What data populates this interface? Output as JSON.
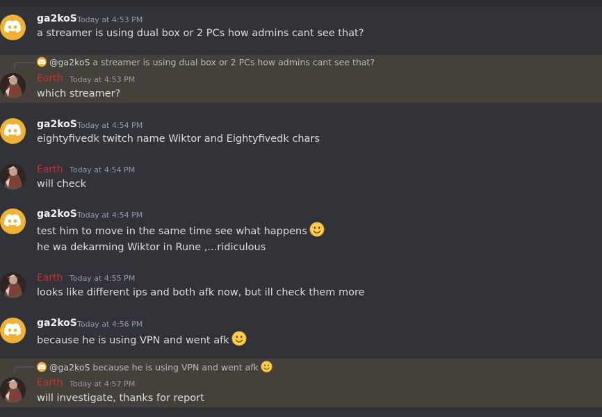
{
  "messages": [
    {
      "author": "ga2koS",
      "time": "Today at 4:53 PM",
      "lines": [
        "a streamer is using dual box or 2 PCs how admins cant see that?"
      ]
    },
    {
      "author": "Earth",
      "time": "Today at 4:53 PM",
      "reply": {
        "author": "@ga2koS",
        "text": "a streamer is using dual box or 2 PCs how admins cant see that?"
      },
      "lines": [
        "which streamer?"
      ]
    },
    {
      "author": "ga2koS",
      "time": "Today at 4:54 PM",
      "lines": [
        "eightyfivedk twitch name Wiktor and Eightyfivedk chars"
      ]
    },
    {
      "author": "Earth",
      "time": "Today at 4:54 PM",
      "lines": [
        "will check"
      ]
    },
    {
      "author": "ga2koS",
      "time": "Today at 4:54 PM",
      "lines": [
        "test him to move in the same time see what happens",
        "he wa dekarming Wiktor in Rune ,...ridiculous"
      ]
    },
    {
      "author": "Earth",
      "time": "Today at 4:55 PM",
      "lines": [
        "looks like different ips and both afk now, but ill check them more"
      ]
    },
    {
      "author": "ga2koS",
      "time": "Today at 4:56 PM",
      "lines": [
        "because he is using VPN and went afk"
      ]
    },
    {
      "author": "Earth",
      "time": "Today at 4:57 PM",
      "reply": {
        "author": "@ga2koS",
        "text": "because he is using VPN and went afk"
      },
      "lines": [
        "will investigate, thanks for report"
      ]
    }
  ],
  "icons": {
    "discord_avatar": "discord-logo-icon",
    "smile": "slightly-smiling-face-emoji"
  },
  "colors": {
    "background": "#313338",
    "highlight": "#45413a",
    "earth_name": "#c7302e",
    "discord_avatar": "#f0b232"
  }
}
